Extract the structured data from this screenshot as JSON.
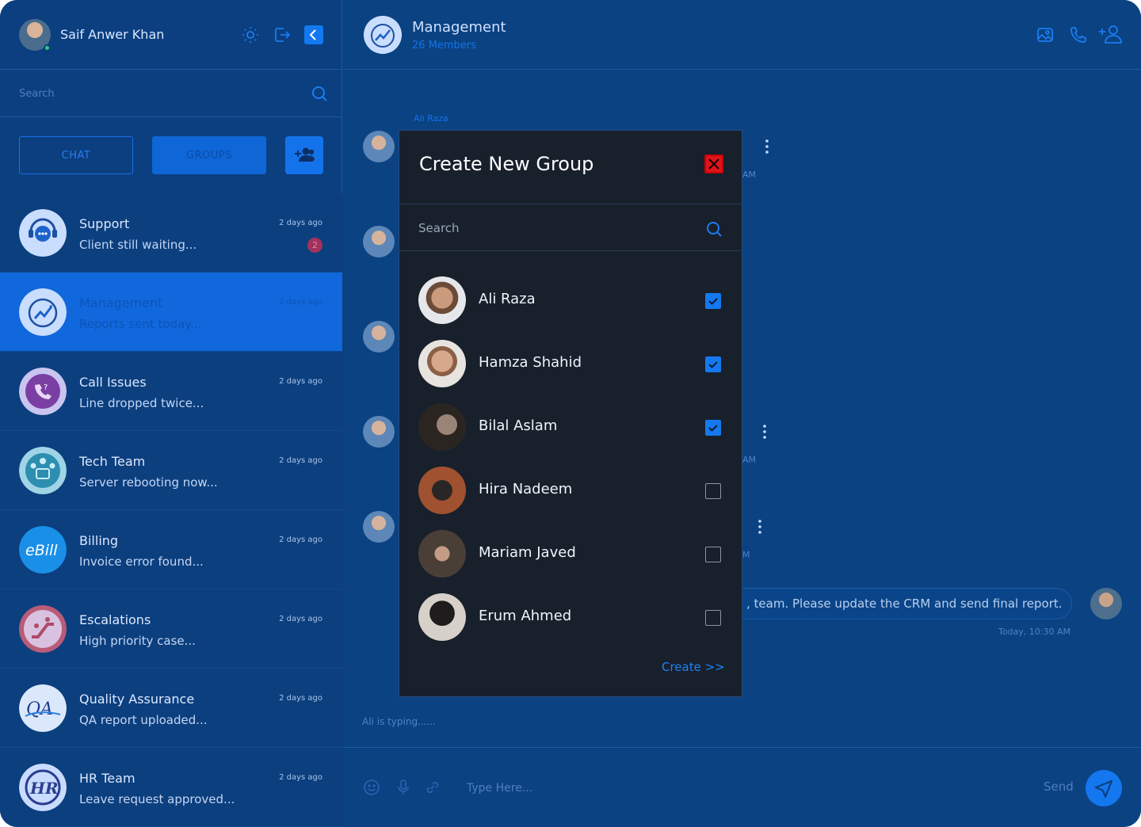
{
  "user": {
    "name": "Saif Anwer Khan",
    "status_color": "#2ecc71"
  },
  "sidebar": {
    "search_placeholder": "Search",
    "tabs": {
      "chat": "CHAT",
      "groups": "GROUPS"
    },
    "conversations": [
      {
        "name": "Support",
        "last": "Client still waiting...",
        "time": "2 days ago",
        "badge": "2",
        "icon": "support-chat-icon"
      },
      {
        "name": "Management",
        "last": "Reports sent today...",
        "time": "2 days ago",
        "icon": "management-growth-icon",
        "active": true
      },
      {
        "name": "Call Issues",
        "last": "Line dropped twice...",
        "time": "2 days ago",
        "icon": "phone-question-icon"
      },
      {
        "name": "Tech Team",
        "last": "Server rebooting now...",
        "time": "2 days ago",
        "icon": "tech-team-icon"
      },
      {
        "name": "Billing",
        "last": "Invoice error found...",
        "time": "2 days ago",
        "icon": "ebill-logo"
      },
      {
        "name": "Escalations",
        "last": "High priority case...",
        "time": "2 days ago",
        "icon": "escalator-icon"
      },
      {
        "name": "Quality Assurance",
        "last": "QA report uploaded...",
        "time": "2 days ago",
        "icon": "qa-logo"
      },
      {
        "name": "HR Team",
        "last": "Leave request approved...",
        "time": "2 days ago",
        "icon": "hr-logo"
      }
    ]
  },
  "chat": {
    "title": "Management",
    "subtitle": "26 Members",
    "first_sender": "Ali Raza",
    "time_fragments": [
      "AM",
      "AM",
      "M"
    ],
    "outgoing_text": ", team. Please update the CRM and send final report.",
    "outgoing_time": "Today, 10:30 AM",
    "typing": "Ali is typing......",
    "composer_placeholder": "Type Here...",
    "send_label": "Send"
  },
  "modal": {
    "title": "Create New Group",
    "search_placeholder": "Search",
    "members": [
      {
        "name": "Ali Raza",
        "checked": true
      },
      {
        "name": "Hamza Shahid",
        "checked": true
      },
      {
        "name": "Bilal Aslam",
        "checked": true
      },
      {
        "name": "Hira Nadeem",
        "checked": false
      },
      {
        "name": "Mariam Javed",
        "checked": false
      },
      {
        "name": "Erum Ahmed",
        "checked": false
      }
    ],
    "create_label": "Create >>"
  },
  "colors": {
    "accent": "#1479f0",
    "sidebar_bg": "#0b3f80",
    "modal_bg": "#18202c",
    "close": "#e0141b"
  }
}
